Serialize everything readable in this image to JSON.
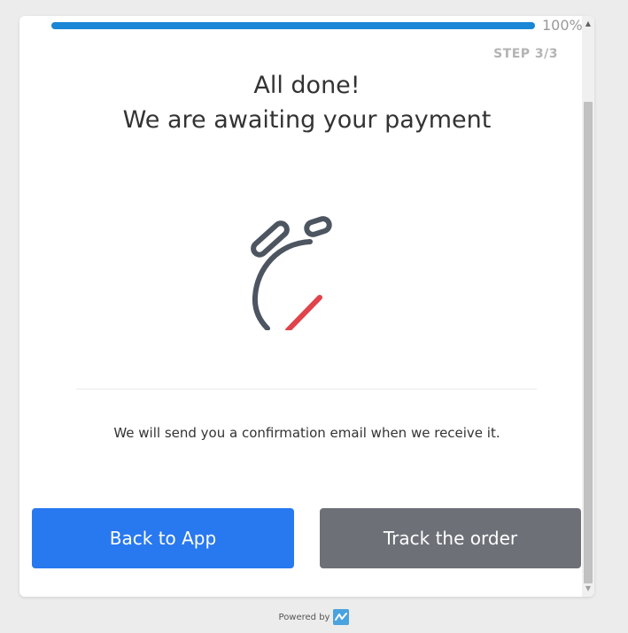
{
  "progress": {
    "percent": 100,
    "label": "100%"
  },
  "step": {
    "label": "STEP 3/3"
  },
  "heading": {
    "line1": "All done!",
    "line2": "We are awaiting your payment"
  },
  "illustration": {
    "icon": "stopwatch-icon",
    "body_color": "#4c5560",
    "hand_color": "#e0434b"
  },
  "message": {
    "text": "We will send you a confirmation email when we receive it."
  },
  "buttons": {
    "back_label": "Back to App",
    "track_label": "Track the order"
  },
  "footer": {
    "powered_label": "Powered by",
    "brand_icon": "brand-logo-icon"
  },
  "colors": {
    "primary": "#2878f0",
    "secondary": "#6d7077",
    "progress": "#1a86d6"
  }
}
